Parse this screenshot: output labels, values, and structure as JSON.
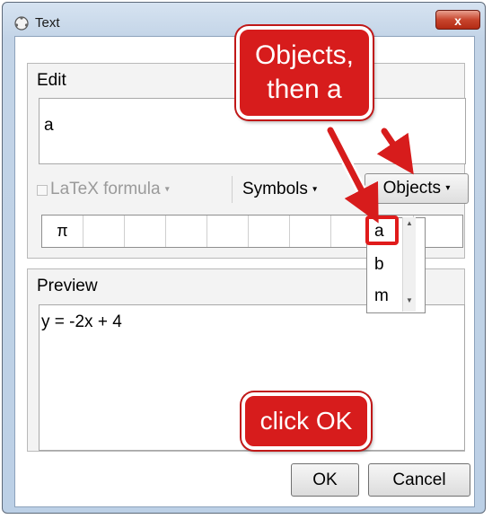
{
  "window": {
    "title": "Text",
    "close_label": "x"
  },
  "edit": {
    "label": "Edit",
    "value": "a"
  },
  "toolbar": {
    "latex_label": "LaTeX formula",
    "symbols_label": "Symbols",
    "objects_label": "Objects",
    "dropdown_caret": "▾"
  },
  "symbols": [
    "π",
    "",
    "",
    "",
    "",
    "",
    "",
    "",
    "",
    ""
  ],
  "objects_list": [
    "a",
    "b",
    "m"
  ],
  "preview": {
    "label": "Preview",
    "value": "y = -2x + 4"
  },
  "buttons": {
    "ok": "OK",
    "cancel": "Cancel"
  },
  "callouts": {
    "top": "Objects,\nthen a",
    "bottom": "click OK"
  },
  "colors": {
    "callout": "#d71c1c",
    "highlight": "#e01b1b"
  }
}
